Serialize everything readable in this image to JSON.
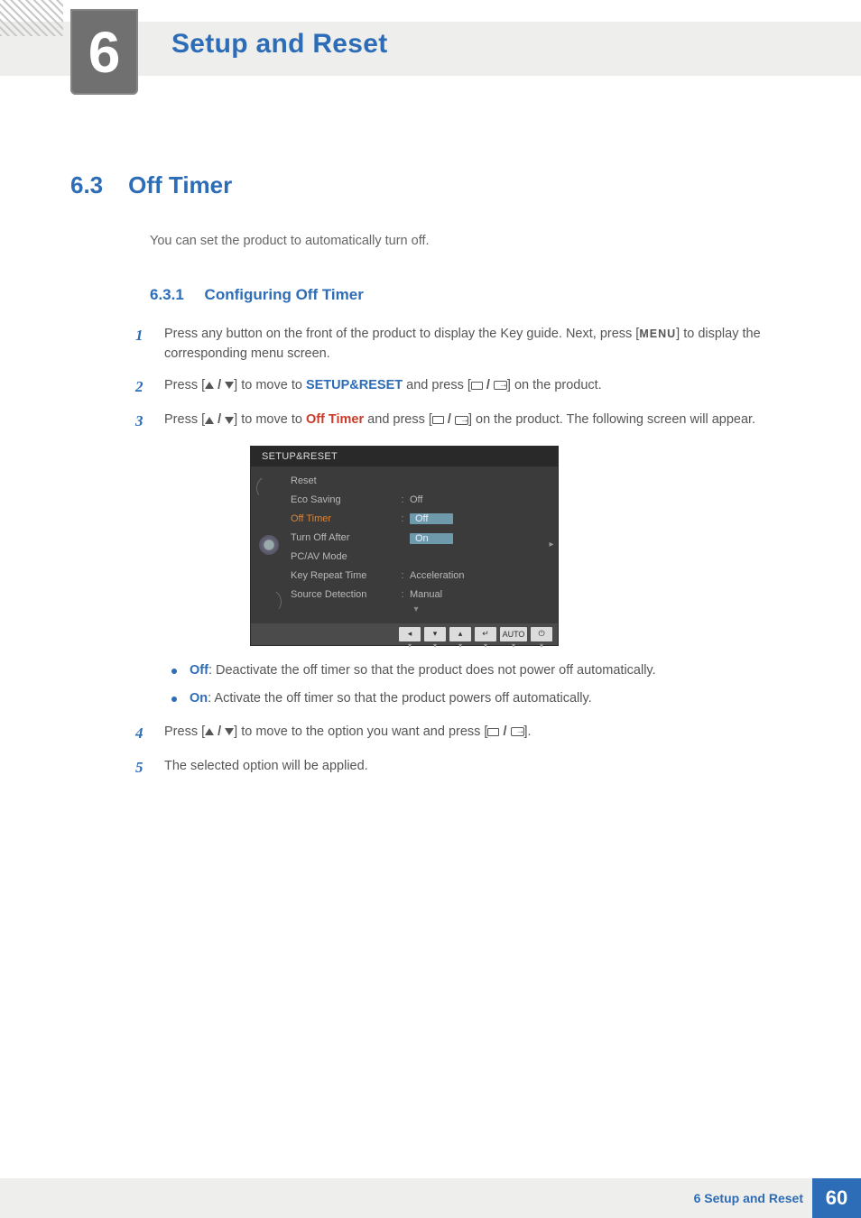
{
  "chapter": {
    "number": "6",
    "title": "Setup and Reset"
  },
  "section": {
    "number": "6.3",
    "title": "Off Timer"
  },
  "intro": "You can set the product to automatically turn off.",
  "subsection": {
    "number": "6.3.1",
    "title": "Configuring Off Timer"
  },
  "steps": {
    "s1": {
      "n": "1",
      "a": "Press any button on the front of the product to display the Key guide. Next, press [",
      "menu": "MENU",
      "b": "] to display the corresponding menu screen."
    },
    "s2": {
      "n": "2",
      "a": "Press [",
      "b": "] to move to ",
      "kw": "SETUP&RESET",
      "c": " and press [",
      "d": "] on the product."
    },
    "s3": {
      "n": "3",
      "a": "Press [",
      "b": "] to move to ",
      "kw": "Off Timer",
      "c": " and press [",
      "d": "] on the product. The following screen will appear."
    },
    "s4": {
      "n": "4",
      "a": "Press [",
      "b": "] to move to the option you want and press [",
      "c": "]."
    },
    "s5": {
      "n": "5",
      "a": "The selected option will be applied."
    }
  },
  "bullets": {
    "off": {
      "kw": "Off",
      "txt": ": Deactivate the off timer so that the product does not power off automatically."
    },
    "on": {
      "kw": "On",
      "txt": ": Activate the off timer so that the product powers off automatically."
    }
  },
  "osd": {
    "title": "SETUP&RESET",
    "rows": {
      "reset": {
        "lbl": "Reset",
        "val": ""
      },
      "eco": {
        "lbl": "Eco Saving",
        "val": "Off"
      },
      "offt": {
        "lbl": "Off Timer",
        "opt1": "Off",
        "opt2": "On"
      },
      "toa": {
        "lbl": "Turn Off After",
        "val": ""
      },
      "pcav": {
        "lbl": "PC/AV Mode",
        "val": ""
      },
      "krt": {
        "lbl": "Key Repeat Time",
        "val": "Acceleration"
      },
      "sd": {
        "lbl": "Source Detection",
        "val": "Manual"
      }
    },
    "foot": {
      "auto": "AUTO"
    }
  },
  "footer": {
    "label": "6 Setup and Reset",
    "page": "60"
  }
}
